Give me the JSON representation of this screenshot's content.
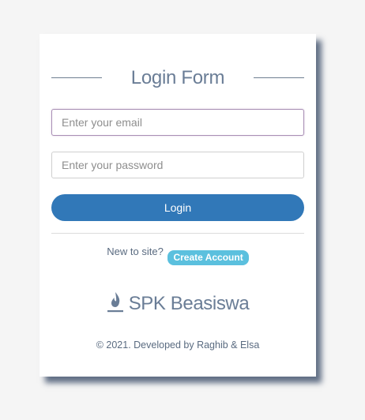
{
  "login_form": {
    "title": "Login Form",
    "email_placeholder": "Enter your email",
    "password_placeholder": "Enter your password",
    "login_label": "Login",
    "signup_prompt": "New to site?",
    "create_account_label": "Create Account"
  },
  "brand": {
    "name": "SPK Beasiswa",
    "icon": "flame-icon"
  },
  "footer": {
    "text": "© 2021. Developed by Raghib & Elsa"
  },
  "colors": {
    "primary": "#3178b8",
    "info": "#5bc0de",
    "heading": "#6a7d96",
    "background": "#f5f5f5"
  }
}
